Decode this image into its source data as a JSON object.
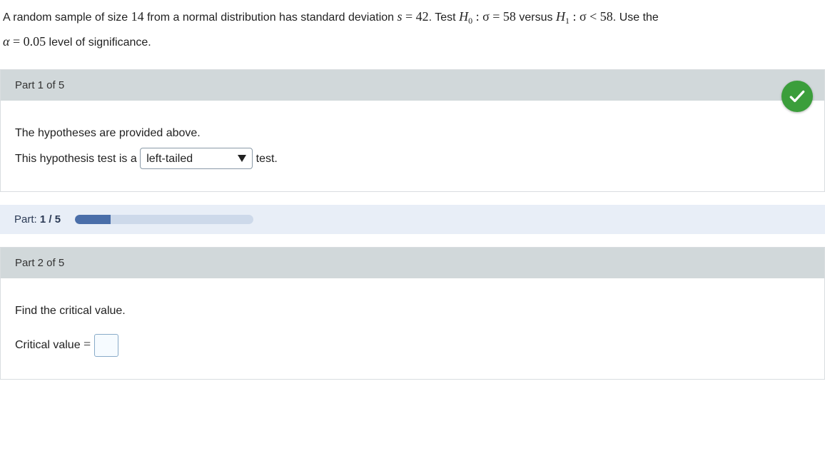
{
  "problem": {
    "prefix": "A random sample of size ",
    "n": "14",
    "mid1": " from a normal distribution has standard deviation ",
    "s_var": "s",
    "eq": " = ",
    "s_val": "42",
    "mid2": ". Test ",
    "h0": "H",
    "h0_sub": "0",
    "h0_text": " : σ = ",
    "h0_val": "58",
    "mid3": " versus ",
    "h1": "H",
    "h1_sub": "1",
    "h1_text": " : σ < ",
    "h1_val": "58",
    "mid4": ". Use the",
    "alpha_var": "α",
    "alpha_eq": " = ",
    "alpha_val": "0.05",
    "alpha_suffix": " level of significance."
  },
  "part1": {
    "header": "Part 1 of 5",
    "line1": "The hypotheses are provided above.",
    "line2_prefix": "This hypothesis test is a ",
    "dropdown_value": "left-tailed",
    "line2_suffix": " test."
  },
  "progress": {
    "label_prefix": "Part: ",
    "current": "1",
    "sep": " / ",
    "total": "5",
    "percent": 20
  },
  "part2": {
    "header": "Part 2 of 5",
    "instruction": "Find the critical value.",
    "answer_label": "Critical value ",
    "eq": "="
  }
}
